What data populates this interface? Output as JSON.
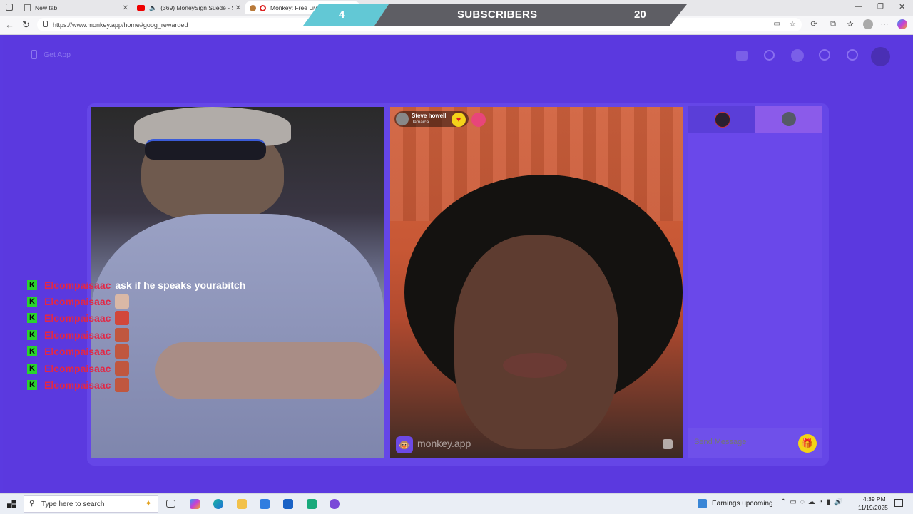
{
  "browser": {
    "tabs": [
      {
        "label": "New tab",
        "active": false
      },
      {
        "label": "(369) MoneySign Suede - Sh",
        "active": false
      },
      {
        "label": "Monkey: Free Live V",
        "active": true
      }
    ],
    "url": "https://www.monkey.app/home#goog_rewarded"
  },
  "overlay": {
    "left_count": "4",
    "label": "SUBSCRIBERS",
    "right_count": "20"
  },
  "page": {
    "get_app": "Get App"
  },
  "video_right": {
    "user_name": "Steve howell",
    "user_location": "Jamaica",
    "watermark": "monkey.app"
  },
  "chat_panel": {
    "send_placeholder": "Send Message"
  },
  "stream_chat": [
    {
      "name": "Elcompaisaac",
      "message": "ask if he speaks yourabitch",
      "emote": ""
    },
    {
      "name": "Elcompaisaac",
      "message": "",
      "emote": "face"
    },
    {
      "name": "Elcompaisaac",
      "message": "",
      "emote": "face"
    },
    {
      "name": "Elcompaisaac",
      "message": "",
      "emote": "face"
    },
    {
      "name": "Elcompaisaac",
      "message": "",
      "emote": "face"
    },
    {
      "name": "Elcompaisaac",
      "message": "",
      "emote": "face"
    },
    {
      "name": "Elcompaisaac",
      "message": "",
      "emote": "face"
    }
  ],
  "taskbar": {
    "search_placeholder": "Type here to search",
    "news": "Earnings upcoming",
    "time": "4:39 PM",
    "date": "11/19/2025"
  },
  "colors": {
    "page_bg": "#5b39df",
    "chat_name": "#e22846",
    "kick_green": "#29d32d",
    "banner_teal": "#62c8d5",
    "banner_gray": "#5e5e64"
  }
}
